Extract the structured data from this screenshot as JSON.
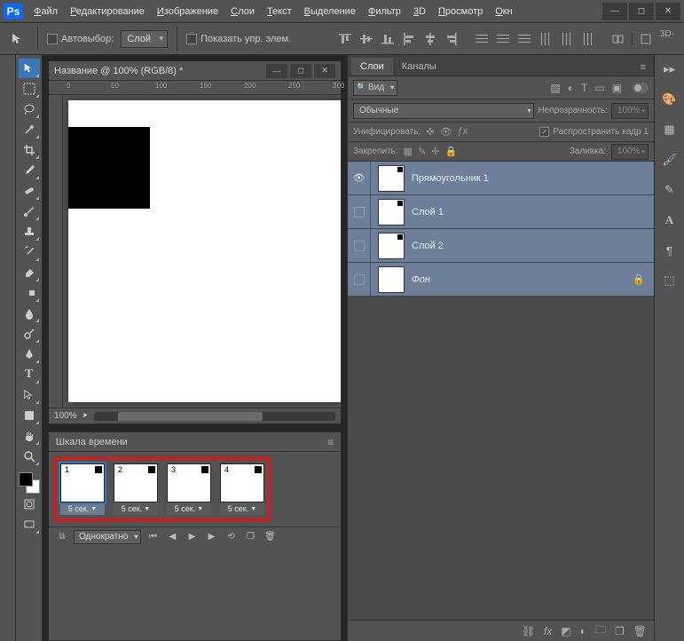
{
  "app": {
    "logo": "Ps"
  },
  "menu": [
    "Файл",
    "Редактирование",
    "Изображение",
    "Слои",
    "Текст",
    "Выделение",
    "Фильтр",
    "3D",
    "Просмотр",
    "Окн"
  ],
  "options": {
    "autoselect_label": "Автовыбор:",
    "autoselect_value": "Слой",
    "show_controls_label": "Показать упр. элем.",
    "threeD": "3D-"
  },
  "document": {
    "title": "Название @ 100% (RGB/8) *",
    "ruler_marks": [
      "0",
      "50",
      "100",
      "150",
      "200",
      "250",
      "300"
    ],
    "zoom": "100%"
  },
  "timeline": {
    "title": "Шкала времени",
    "loop": "Однократно",
    "frames": [
      {
        "n": "1",
        "delay": "5 сек."
      },
      {
        "n": "2",
        "delay": "5 сек."
      },
      {
        "n": "3",
        "delay": "5 сек."
      },
      {
        "n": "4",
        "delay": "5 сек."
      }
    ]
  },
  "panels": {
    "tabs": {
      "layers": "Слои",
      "channels": "Каналы"
    },
    "filter_kind": "Вид",
    "blend_mode": "Обычные",
    "opacity_label": "Непрозрачность:",
    "opacity_value": "100%",
    "unify_label": "Унифицировать:",
    "propagate_label": "Распространить кадр 1",
    "lock_label": "Закрепить:",
    "fill_label": "Заливка:",
    "fill_value": "100%",
    "layers": [
      {
        "name": "Прямоугольник 1",
        "visible": true,
        "locked": false,
        "italic": false
      },
      {
        "name": "Слой 1",
        "visible": false,
        "locked": false,
        "italic": false
      },
      {
        "name": "Слой 2",
        "visible": false,
        "locked": false,
        "italic": false
      },
      {
        "name": "Фон",
        "visible": false,
        "locked": true,
        "italic": true
      }
    ]
  }
}
